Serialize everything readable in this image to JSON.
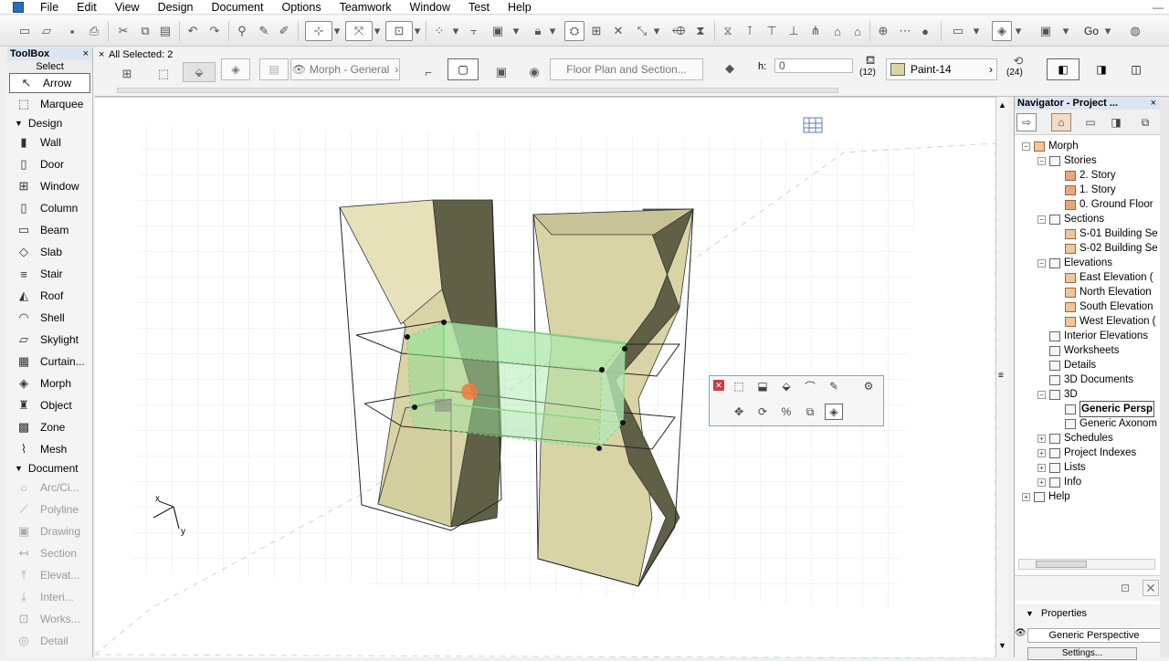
{
  "menu": [
    "File",
    "Edit",
    "View",
    "Design",
    "Document",
    "Options",
    "Teamwork",
    "Window",
    "Test",
    "Help"
  ],
  "window_control": "—",
  "toolbox": {
    "title": "ToolBox",
    "close": "×",
    "select_label": "Select",
    "tools_select": [
      {
        "label": "Arrow",
        "icon": "arrow-icon",
        "glyph": "↖"
      },
      {
        "label": "Marquee",
        "icon": "marquee-icon",
        "glyph": "⬚"
      }
    ],
    "design_label": "Design",
    "tools_design": [
      {
        "label": "Wall",
        "icon": "wall-icon",
        "glyph": "▮"
      },
      {
        "label": "Door",
        "icon": "door-icon",
        "glyph": "▯"
      },
      {
        "label": "Window",
        "icon": "window-icon",
        "glyph": "⊞"
      },
      {
        "label": "Column",
        "icon": "column-icon",
        "glyph": "▯"
      },
      {
        "label": "Beam",
        "icon": "beam-icon",
        "glyph": "▭"
      },
      {
        "label": "Slab",
        "icon": "slab-icon",
        "glyph": "◇"
      },
      {
        "label": "Stair",
        "icon": "stair-icon",
        "glyph": "≡"
      },
      {
        "label": "Roof",
        "icon": "roof-icon",
        "glyph": "◭"
      },
      {
        "label": "Shell",
        "icon": "shell-icon",
        "glyph": "◠"
      },
      {
        "label": "Skylight",
        "icon": "skylight-icon",
        "glyph": "▱"
      },
      {
        "label": "Curtain...",
        "icon": "curtain-wall-icon",
        "glyph": "▦"
      },
      {
        "label": "Morph",
        "icon": "morph-icon",
        "glyph": "◈"
      },
      {
        "label": "Object",
        "icon": "object-icon",
        "glyph": "♜"
      },
      {
        "label": "Zone",
        "icon": "zone-icon",
        "glyph": "▩"
      },
      {
        "label": "Mesh",
        "icon": "mesh-icon",
        "glyph": "⌇"
      }
    ],
    "document_label": "Document",
    "tools_document": [
      {
        "label": "Arc/Ci...",
        "icon": "arc-icon",
        "glyph": "○"
      },
      {
        "label": "Polyline",
        "icon": "polyline-icon",
        "glyph": "⟋"
      },
      {
        "label": "Drawing",
        "icon": "drawing-icon",
        "glyph": "▣"
      },
      {
        "label": "Section",
        "icon": "section-icon",
        "glyph": "↤"
      },
      {
        "label": "Elevat...",
        "icon": "elevation-icon",
        "glyph": "⤒"
      },
      {
        "label": "Interi...",
        "icon": "interior-elevation-icon",
        "glyph": "⤓"
      },
      {
        "label": "Works...",
        "icon": "worksheet-icon",
        "glyph": "⊡"
      },
      {
        "label": "Detail",
        "icon": "detail-icon",
        "glyph": "◎"
      }
    ]
  },
  "infobox": {
    "close": "×",
    "all_selected": "All Selected: 2",
    "morph_layer": "Morph - General",
    "floor_plan": "Floor Plan and Section...",
    "h_label": "h:",
    "h_value": "0",
    "paint_count": "(12)",
    "paint_name": "Paint-14",
    "count_24": "(24)"
  },
  "navigator": {
    "title": "Navigator - Project ...",
    "close": "×",
    "tree": [
      {
        "label": "Morph",
        "depth": 0,
        "pm": "−",
        "icon": "house",
        "name": "tree-morph"
      },
      {
        "label": "Stories",
        "depth": 1,
        "pm": "−",
        "icon": "plain",
        "name": "tree-stories"
      },
      {
        "label": "2. Story",
        "depth": 2,
        "pm": "",
        "icon": "orange",
        "name": "tree-story-2"
      },
      {
        "label": "1. Story",
        "depth": 2,
        "pm": "",
        "icon": "orange",
        "name": "tree-story-1"
      },
      {
        "label": "0. Ground Floor",
        "depth": 2,
        "pm": "",
        "icon": "orange",
        "name": "tree-ground-floor"
      },
      {
        "label": "Sections",
        "depth": 1,
        "pm": "−",
        "icon": "plain",
        "name": "tree-sections"
      },
      {
        "label": "S-01 Building Se",
        "depth": 2,
        "pm": "",
        "icon": "house",
        "name": "tree-section-s01"
      },
      {
        "label": "S-02 Building Se",
        "depth": 2,
        "pm": "",
        "icon": "house",
        "name": "tree-section-s02"
      },
      {
        "label": "Elevations",
        "depth": 1,
        "pm": "−",
        "icon": "plain",
        "name": "tree-elevations"
      },
      {
        "label": "East Elevation (",
        "depth": 2,
        "pm": "",
        "icon": "house",
        "name": "tree-east-elevation"
      },
      {
        "label": "North Elevation",
        "depth": 2,
        "pm": "",
        "icon": "house",
        "name": "tree-north-elevation"
      },
      {
        "label": "South Elevation",
        "depth": 2,
        "pm": "",
        "icon": "house",
        "name": "tree-south-elevation"
      },
      {
        "label": "West Elevation (",
        "depth": 2,
        "pm": "",
        "icon": "house",
        "name": "tree-west-elevation"
      },
      {
        "label": "Interior Elevations",
        "depth": 1,
        "pm": "",
        "icon": "plain",
        "name": "tree-interior-elevations"
      },
      {
        "label": "Worksheets",
        "depth": 1,
        "pm": "",
        "icon": "plain",
        "name": "tree-worksheets"
      },
      {
        "label": "Details",
        "depth": 1,
        "pm": "",
        "icon": "plain",
        "name": "tree-details"
      },
      {
        "label": "3D Documents",
        "depth": 1,
        "pm": "",
        "icon": "plain",
        "name": "tree-3d-documents"
      },
      {
        "label": "3D",
        "depth": 1,
        "pm": "−",
        "icon": "plain",
        "name": "tree-3d"
      },
      {
        "label": "Generic Persp",
        "depth": 2,
        "pm": "",
        "icon": "eye",
        "name": "tree-generic-perspective",
        "bold": true
      },
      {
        "label": "Generic Axonom",
        "depth": 2,
        "pm": "",
        "icon": "cube",
        "name": "tree-generic-axonometry"
      },
      {
        "label": "Schedules",
        "depth": 1,
        "pm": "+",
        "icon": "plain",
        "name": "tree-schedules"
      },
      {
        "label": "Project Indexes",
        "depth": 1,
        "pm": "+",
        "icon": "plain",
        "name": "tree-project-indexes"
      },
      {
        "label": "Lists",
        "depth": 1,
        "pm": "+",
        "icon": "plain",
        "name": "tree-lists"
      },
      {
        "label": "Info",
        "depth": 1,
        "pm": "+",
        "icon": "plain",
        "name": "tree-info"
      },
      {
        "label": "Help",
        "depth": 0,
        "pm": "+",
        "icon": "plain",
        "name": "tree-help"
      }
    ],
    "properties_label": "Properties",
    "properties_value": "Generic Perspective",
    "settings_label": "Settings..."
  },
  "viewport": {
    "axis_x": "x",
    "axis_y": "y"
  },
  "colors": {
    "morph_face": "#d9d4a6",
    "morph_shadow": "#5f6046",
    "selection_green": "#7fd67f",
    "grid": "#dce8ec"
  }
}
